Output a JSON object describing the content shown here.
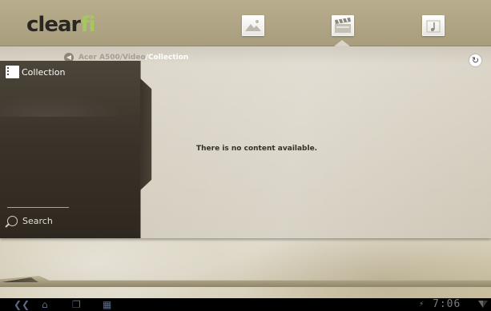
{
  "app": {
    "logo_text_main": "clear",
    "logo_text_accent": "fi"
  },
  "tabs": [
    {
      "name": "photos",
      "icon": "image-icon",
      "selected": false
    },
    {
      "name": "videos",
      "icon": "clapperboard-icon",
      "selected": true
    },
    {
      "name": "music",
      "icon": "music-icon",
      "selected": false
    }
  ],
  "breadcrumb": {
    "prefix": "Acer A500/Video",
    "separator": "/",
    "current": "Collection"
  },
  "sidebar": {
    "items": [
      {
        "label": "Collection",
        "icon": "collection-icon"
      }
    ],
    "search_label": "Search"
  },
  "main": {
    "empty_message": "There is no content available."
  },
  "statusbar": {
    "time": "7:06"
  },
  "colors": {
    "logo_accent": "#a5c85a",
    "sidebar_bg": "#3a332a",
    "divider": "#c9a54a",
    "nav_icons": "#596a86"
  }
}
